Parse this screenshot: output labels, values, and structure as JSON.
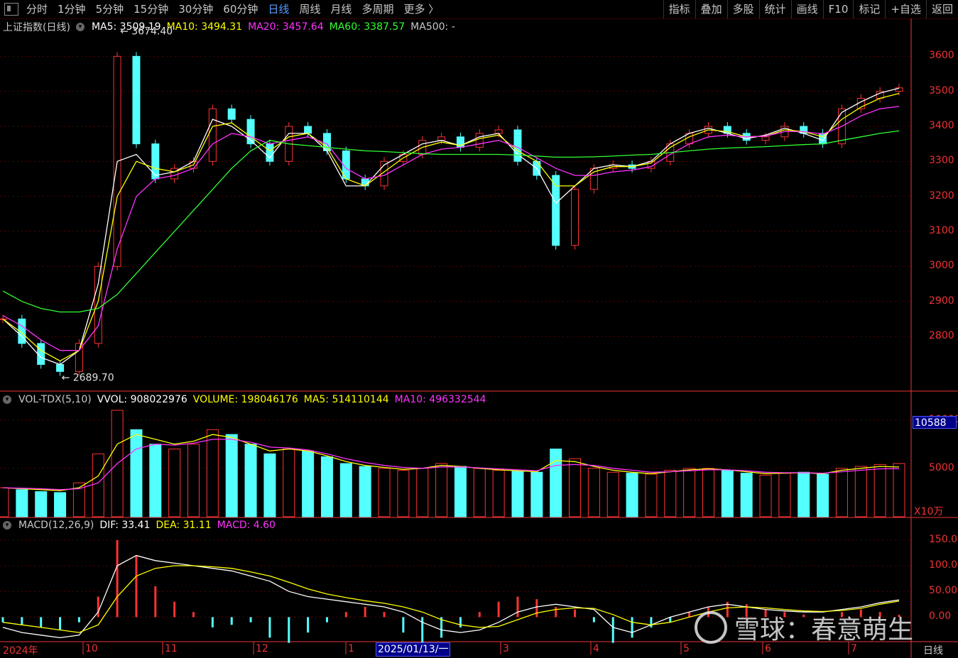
{
  "toolbar": {
    "periods": [
      "分时",
      "1分钟",
      "5分钟",
      "15分钟",
      "30分钟",
      "60分钟",
      "日线",
      "周线",
      "月线",
      "多周期",
      "更多 〉"
    ],
    "active_period": "日线",
    "right_buttons": [
      "指标",
      "叠加",
      "多股",
      "统计",
      "画线",
      "F10",
      "标记",
      "+自选",
      "返回"
    ]
  },
  "main_legend": {
    "name": "上证指数(日线)",
    "ma5": "MA5: 3509.19",
    "ma10": "MA10: 3494.31",
    "ma20": "MA20: 3457.64",
    "ma60": "MA60: 3387.57",
    "ma500": "MA500: -"
  },
  "annotations": {
    "high": "3674.40",
    "low": "2689.70"
  },
  "vol_legend": {
    "name": "VOL-TDX(5,10)",
    "vvol": "VVOL: 908022976",
    "volume": "VOLUME: 198046176",
    "ma5": "MA5: 514110144",
    "ma10": "MA10: 496332544"
  },
  "vol_readout": "10588",
  "vol_unit": "X10万",
  "macd_legend": {
    "name": "MACD(12,26,9)",
    "dif": "DIF: 33.41",
    "dea": "DEA: 31.11",
    "macd": "MACD: 4.60"
  },
  "xaxis": {
    "year": "2024年",
    "months": [
      "10",
      "11",
      "12",
      "1",
      "3",
      "4",
      "5",
      "6",
      "7"
    ],
    "cursor_date": "2025/01/13/一",
    "period": "日线"
  },
  "watermark": "雪球：春意萌生",
  "colors": {
    "up": "#ff3333",
    "down": "#54ffff",
    "ma5": "#ffffff",
    "ma10": "#ffff00",
    "ma20": "#ff33ff",
    "ma60": "#33ff33",
    "axis": "#e33"
  },
  "chart_data": [
    {
      "type": "candlestick",
      "title": "上证指数(日线)",
      "y_ticks": [
        2800,
        2900,
        3000,
        3100,
        3200,
        3300,
        3400,
        3500,
        3600
      ],
      "ylim": [
        2650,
        3700
      ],
      "x": [
        "2024-09",
        "2024-10",
        "2024-11",
        "2024-12",
        "2025-01",
        "2025-02",
        "2025-03",
        "2025-04",
        "2025-05",
        "2025-06",
        "2025-07"
      ],
      "close_path": [
        2850,
        2780,
        2720,
        2700,
        2780,
        3000,
        3600,
        3350,
        3250,
        3280,
        3300,
        3450,
        3420,
        3350,
        3300,
        3400,
        3380,
        3330,
        3250,
        3230,
        3300,
        3320,
        3360,
        3370,
        3340,
        3380,
        3390,
        3300,
        3260,
        3060,
        3220,
        3280,
        3290,
        3280,
        3300,
        3350,
        3380,
        3400,
        3380,
        3360,
        3370,
        3400,
        3380,
        3350,
        3450,
        3480,
        3500,
        3510
      ],
      "series": [
        {
          "name": "MA5",
          "values": [
            2850,
            2800,
            2740,
            2720,
            2760,
            2950,
            3300,
            3320,
            3260,
            3270,
            3300,
            3420,
            3400,
            3360,
            3310,
            3380,
            3380,
            3330,
            3230,
            3230,
            3290,
            3320,
            3350,
            3360,
            3345,
            3370,
            3380,
            3320,
            3280,
            3180,
            3230,
            3280,
            3290,
            3285,
            3300,
            3350,
            3380,
            3395,
            3380,
            3365,
            3375,
            3395,
            3380,
            3360,
            3440,
            3470,
            3495,
            3509
          ]
        },
        {
          "name": "MA10",
          "values": [
            2850,
            2810,
            2760,
            2730,
            2760,
            2900,
            3200,
            3300,
            3280,
            3270,
            3290,
            3400,
            3410,
            3370,
            3330,
            3370,
            3380,
            3340,
            3250,
            3230,
            3270,
            3310,
            3340,
            3355,
            3345,
            3365,
            3375,
            3330,
            3300,
            3230,
            3230,
            3270,
            3285,
            3285,
            3295,
            3340,
            3370,
            3390,
            3385,
            3370,
            3372,
            3390,
            3385,
            3370,
            3420,
            3455,
            3480,
            3494
          ]
        },
        {
          "name": "MA20",
          "values": [
            2860,
            2830,
            2790,
            2760,
            2760,
            2830,
            3050,
            3200,
            3250,
            3260,
            3280,
            3350,
            3380,
            3370,
            3350,
            3360,
            3370,
            3350,
            3280,
            3250,
            3260,
            3290,
            3320,
            3335,
            3340,
            3350,
            3360,
            3340,
            3310,
            3280,
            3260,
            3260,
            3270,
            3275,
            3285,
            3320,
            3350,
            3370,
            3375,
            3370,
            3372,
            3385,
            3385,
            3378,
            3400,
            3430,
            3450,
            3457
          ]
        },
        {
          "name": "MA60",
          "values": [
            2930,
            2900,
            2880,
            2870,
            2870,
            2880,
            2920,
            2980,
            3040,
            3100,
            3160,
            3220,
            3280,
            3330,
            3360,
            3350,
            3345,
            3340,
            3335,
            3330,
            3328,
            3325,
            3322,
            3320,
            3320,
            3320,
            3320,
            3318,
            3315,
            3312,
            3312,
            3313,
            3315,
            3318,
            3320,
            3325,
            3330,
            3335,
            3338,
            3340,
            3342,
            3345,
            3348,
            3350,
            3360,
            3370,
            3380,
            3387
          ]
        }
      ]
    },
    {
      "type": "bar",
      "title": "VOL-TDX(5,10)",
      "y_ticks": [
        5000,
        10000
      ],
      "ylim": [
        0,
        11000
      ],
      "values": [
        3000,
        2800,
        2600,
        2500,
        3500,
        6500,
        11000,
        9000,
        7500,
        7000,
        7500,
        9000,
        8500,
        7500,
        6500,
        7000,
        6800,
        6200,
        5500,
        5200,
        5000,
        4800,
        5000,
        5500,
        5200,
        5000,
        4800,
        4700,
        4600,
        7000,
        6000,
        5000,
        4600,
        4500,
        4400,
        4800,
        5000,
        5000,
        4800,
        4500,
        4300,
        4500,
        4600,
        4400,
        5000,
        5200,
        5400,
        5500
      ],
      "series": [
        {
          "name": "MA5",
          "values": [
            3000,
            2900,
            2800,
            2700,
            3000,
            4200,
            7500,
            8500,
            8000,
            7500,
            7800,
            8500,
            8200,
            7500,
            6800,
            7000,
            6800,
            6300,
            5700,
            5300,
            5100,
            4900,
            5000,
            5300,
            5200,
            5000,
            4850,
            4750,
            4650,
            5800,
            5700,
            5200,
            4800,
            4600,
            4450,
            4650,
            4850,
            4950,
            4850,
            4650,
            4450,
            4500,
            4550,
            4450,
            4800,
            5000,
            5200,
            5141
          ]
        },
        {
          "name": "MA10",
          "values": [
            3000,
            2950,
            2900,
            2800,
            2900,
            3500,
            5500,
            7000,
            7500,
            7400,
            7600,
            8000,
            8000,
            7700,
            7200,
            7100,
            6900,
            6500,
            6000,
            5600,
            5300,
            5100,
            5000,
            5150,
            5150,
            5050,
            4950,
            4850,
            4750,
            5300,
            5400,
            5300,
            5000,
            4800,
            4600,
            4650,
            4750,
            4850,
            4850,
            4750,
            4600,
            4550,
            4550,
            4500,
            4650,
            4800,
            4950,
            4963
          ]
        }
      ]
    },
    {
      "type": "bar",
      "title": "MACD(12,26,9)",
      "y_ticks": [
        0,
        50,
        100,
        150
      ],
      "ylim": [
        -45,
        165
      ],
      "values": [
        -10,
        -15,
        -20,
        -25,
        -10,
        40,
        150,
        120,
        60,
        30,
        10,
        -20,
        -15,
        -10,
        -40,
        -50,
        -30,
        -10,
        10,
        20,
        10,
        -30,
        -50,
        -40,
        -20,
        10,
        30,
        40,
        35,
        20,
        15,
        -10,
        -50,
        -40,
        -20,
        -10,
        10,
        20,
        30,
        25,
        15,
        10,
        5,
        0,
        10,
        15,
        10,
        4.6
      ],
      "series": [
        {
          "name": "DIF",
          "values": [
            -20,
            -30,
            -35,
            -40,
            -35,
            10,
            100,
            120,
            110,
            105,
            100,
            95,
            90,
            80,
            70,
            50,
            40,
            35,
            30,
            25,
            20,
            10,
            -10,
            -25,
            -30,
            -25,
            -10,
            10,
            20,
            25,
            20,
            15,
            -20,
            -30,
            -15,
            0,
            10,
            20,
            25,
            20,
            15,
            12,
            10,
            10,
            15,
            20,
            28,
            33.41
          ]
        },
        {
          "name": "DEA",
          "values": [
            -10,
            -15,
            -20,
            -25,
            -30,
            -15,
            40,
            80,
            95,
            100,
            100,
            98,
            95,
            88,
            80,
            68,
            55,
            45,
            38,
            32,
            27,
            20,
            10,
            -5,
            -15,
            -20,
            -18,
            -5,
            8,
            15,
            18,
            17,
            5,
            -10,
            -15,
            -10,
            0,
            10,
            18,
            20,
            18,
            15,
            12,
            11,
            13,
            17,
            25,
            31.11
          ]
        }
      ]
    }
  ]
}
